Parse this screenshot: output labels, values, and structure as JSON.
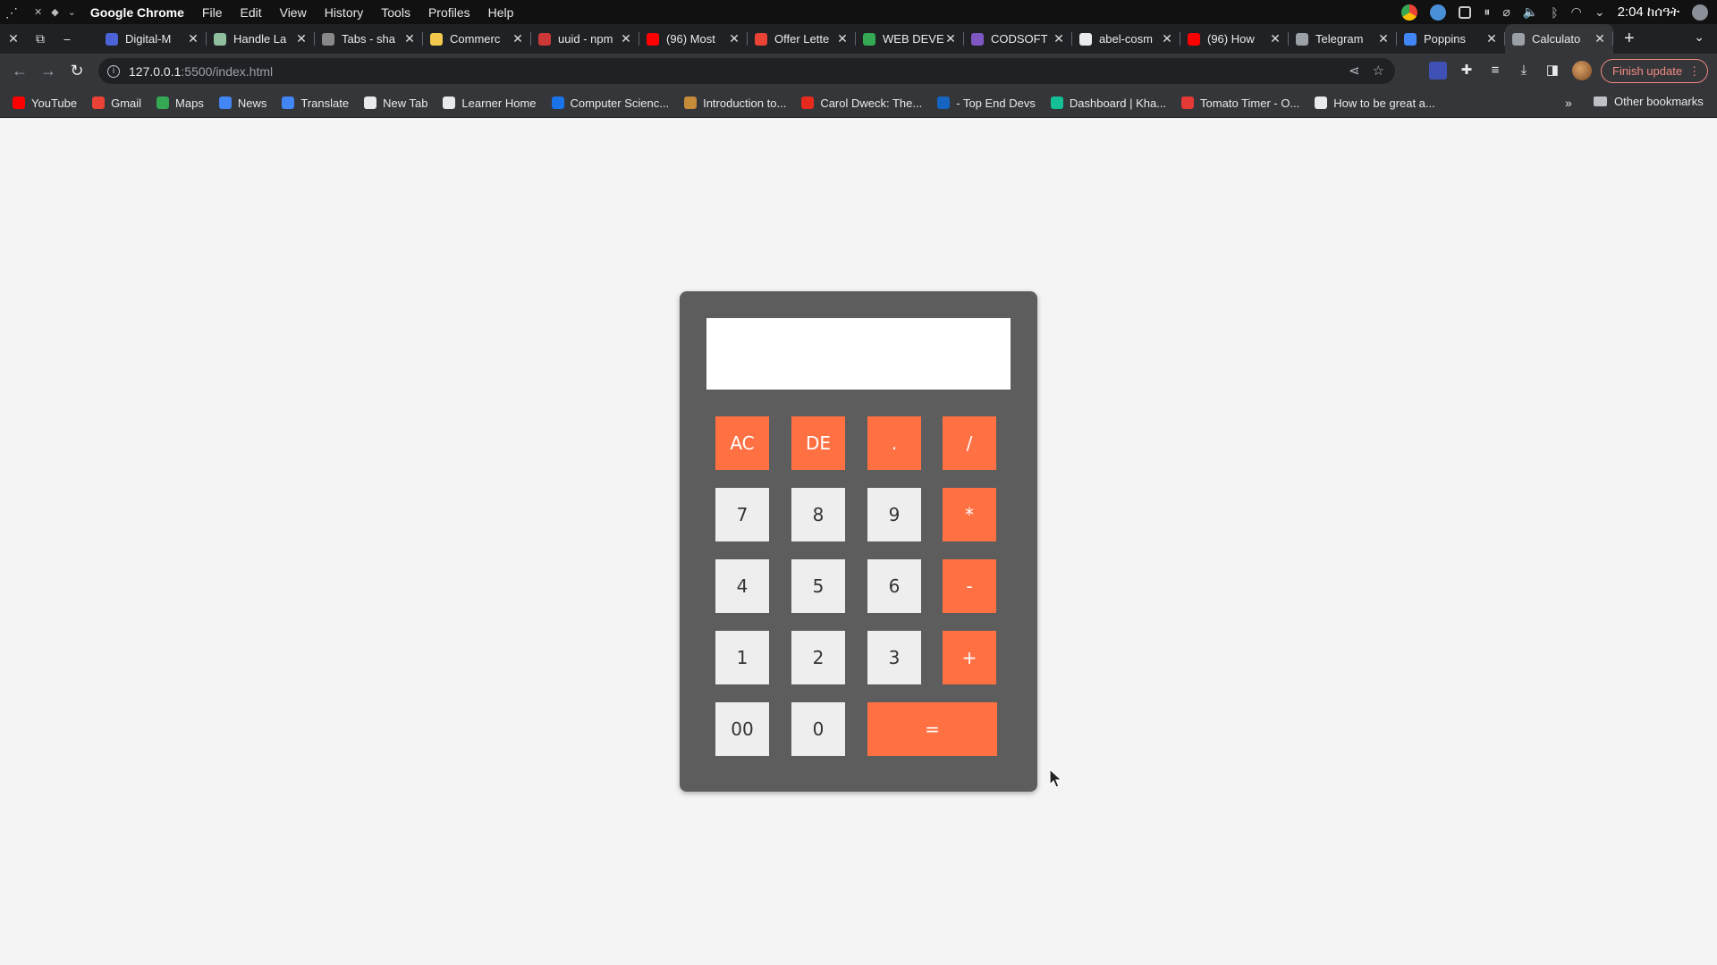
{
  "os": {
    "app_name": "Google Chrome",
    "menus": [
      "File",
      "Edit",
      "View",
      "History",
      "Tools",
      "Profiles",
      "Help"
    ],
    "clock": "2:04 ከሰዓት"
  },
  "tabs": [
    {
      "title": "Digital-M",
      "color": "#4a63d6"
    },
    {
      "title": "Handle La",
      "color": "#8fbf9f"
    },
    {
      "title": "Tabs - sha",
      "color": "#888888"
    },
    {
      "title": "Commerc",
      "color": "#f2c94c"
    },
    {
      "title": "uuid - npm",
      "color": "#cb3837"
    },
    {
      "title": "(96) Most",
      "color": "#ff0000"
    },
    {
      "title": "Offer Lette",
      "color": "#ea4335"
    },
    {
      "title": "WEB DEVE",
      "color": "#34a853"
    },
    {
      "title": "CODSOFT",
      "color": "#7e57c2"
    },
    {
      "title": "abel-cosm",
      "color": "#e8eaed"
    },
    {
      "title": "(96) How",
      "color": "#ff0000"
    },
    {
      "title": "Telegram",
      "color": "#9aa0a6"
    },
    {
      "title": "Poppins",
      "color": "#4285f4"
    },
    {
      "title": "Calculato",
      "color": "#9aa0a6"
    }
  ],
  "toolbar": {
    "url_host": "127.0.0.1",
    "url_path": ":5500/index.html",
    "finish_update": "Finish update"
  },
  "bookmarks": [
    {
      "label": "YouTube",
      "color": "#ff0000"
    },
    {
      "label": "Gmail",
      "color": "#ea4335"
    },
    {
      "label": "Maps",
      "color": "#34a853"
    },
    {
      "label": "News",
      "color": "#4285f4"
    },
    {
      "label": "Translate",
      "color": "#4285f4"
    },
    {
      "label": "New Tab",
      "color": "#e8eaed"
    },
    {
      "label": "Learner Home",
      "color": "#e8eaed"
    },
    {
      "label": "Computer Scienc...",
      "color": "#1a73e8"
    },
    {
      "label": "Introduction to...",
      "color": "#c58a3a"
    },
    {
      "label": "Carol Dweck: The...",
      "color": "#e62b1e"
    },
    {
      "label": "- Top End Devs",
      "color": "#1565c0"
    },
    {
      "label": "Dashboard | Kha...",
      "color": "#14bf96"
    },
    {
      "label": "Tomato Timer - O...",
      "color": "#e53935"
    },
    {
      "label": "How to be great a...",
      "color": "#e8eaed"
    }
  ],
  "bookmarks_other": "Other bookmarks",
  "calculator": {
    "display_value": "",
    "keys": [
      "AC",
      "DE",
      ".",
      "/",
      "7",
      "8",
      "9",
      "*",
      "4",
      "5",
      "6",
      "-",
      "1",
      "2",
      "3",
      "+",
      "00",
      "0",
      "="
    ],
    "colors": {
      "body": "#5d5d5d",
      "number_key": "#eeeeee",
      "operator_key": "#ff7043",
      "display": "#ffffff"
    }
  }
}
